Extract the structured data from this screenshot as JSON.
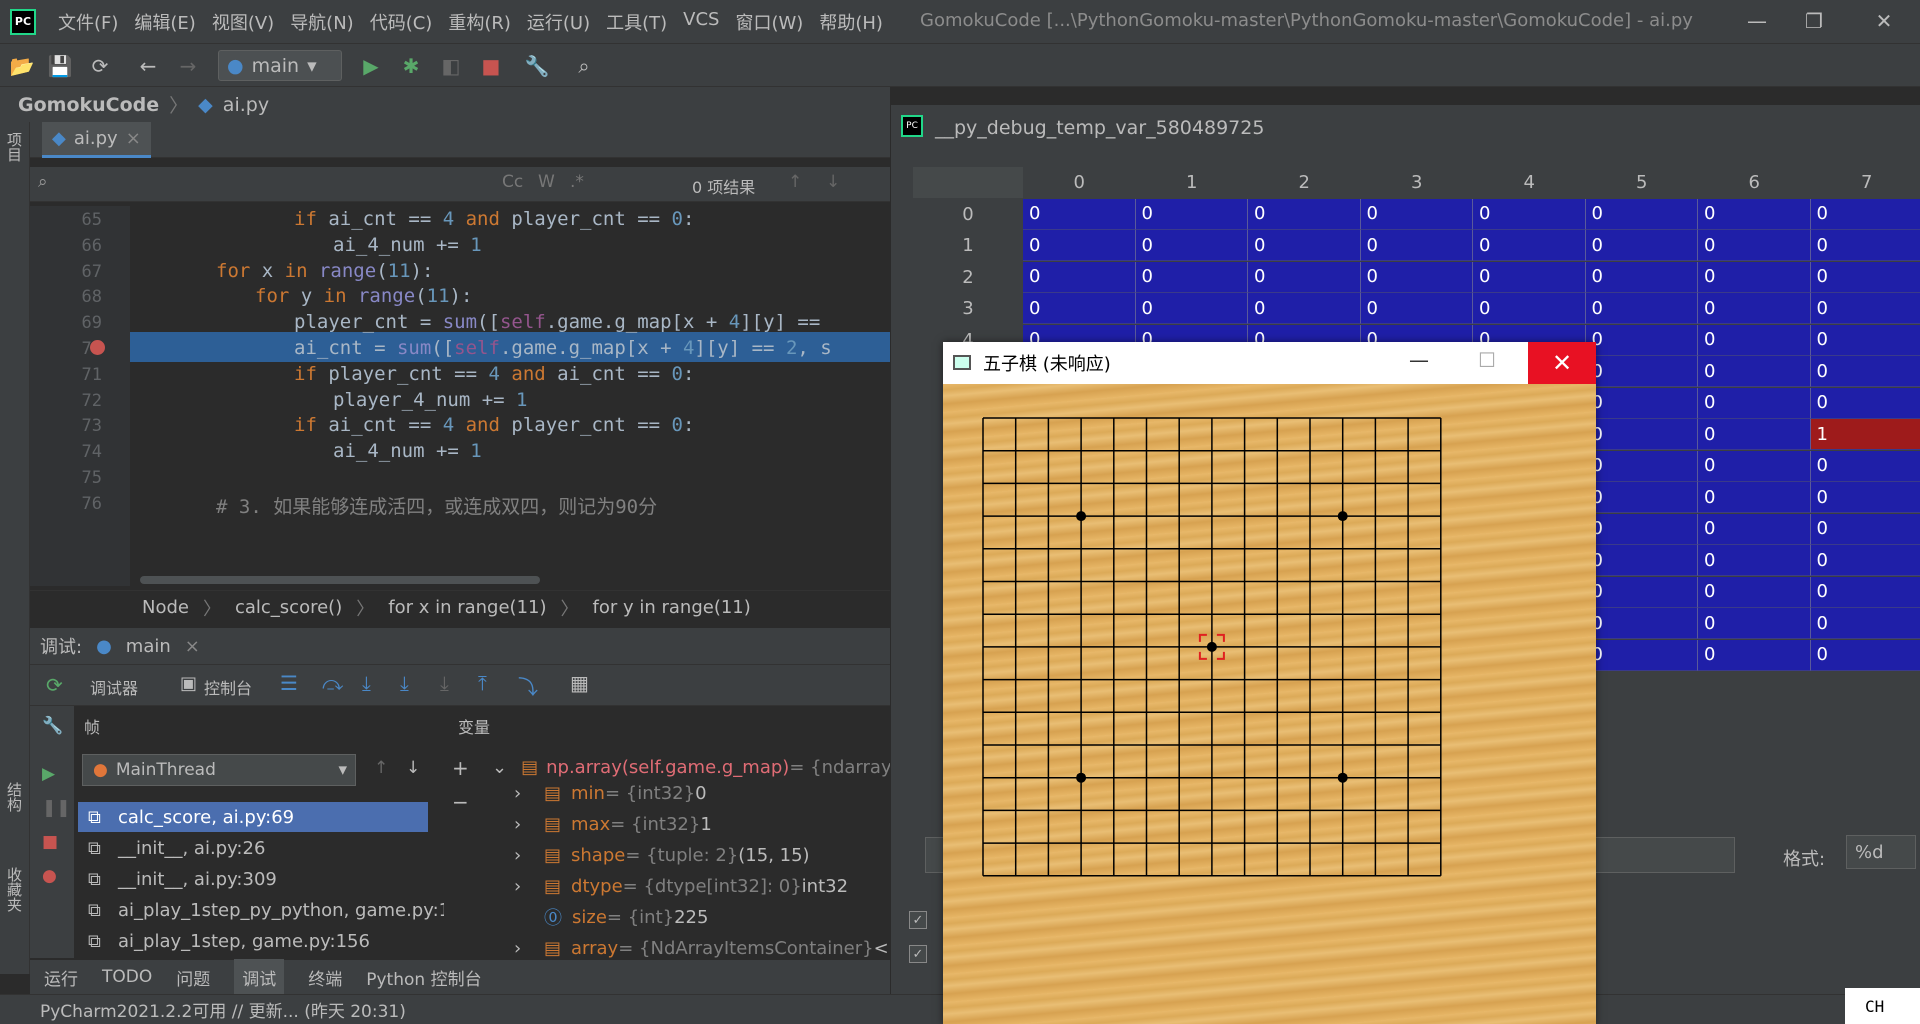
{
  "titlebar": {
    "menus": [
      "文件(F)",
      "编辑(E)",
      "视图(V)",
      "导航(N)",
      "代码(C)",
      "重构(R)",
      "运行(U)",
      "工具(T)",
      "VCS",
      "窗口(W)",
      "帮助(H)"
    ],
    "window_title": "GomokuCode [...\\PythonGomoku-master\\PythonGomoku-master\\GomokuCode] - ai.py"
  },
  "toolbar": {
    "run_config": "main"
  },
  "navbar": {
    "project": "GomokuCode",
    "file": "ai.py"
  },
  "left_strip": {
    "project": "项目",
    "structure": "结构",
    "favorites": "收藏夹"
  },
  "editor": {
    "tab": "ai.py",
    "find_results": "0 项结果",
    "lines": [
      {
        "n": "65",
        "indent": 4,
        "tokens": [
          [
            "kw",
            "if "
          ],
          [
            "",
            "ai_cnt == "
          ],
          [
            "num",
            "4"
          ],
          [
            "kw",
            " and "
          ],
          [
            "",
            "player_cnt == "
          ],
          [
            "num",
            "0"
          ],
          [
            "",
            ":"
          ]
        ]
      },
      {
        "n": "66",
        "indent": 5,
        "tokens": [
          [
            "",
            "ai_4_num += "
          ],
          [
            "num",
            "1"
          ]
        ]
      },
      {
        "n": "67",
        "indent": 2,
        "tokens": [
          [
            "kw",
            "for "
          ],
          [
            "",
            "x "
          ],
          [
            "kw",
            "in "
          ],
          [
            "bi",
            "range"
          ],
          [
            "",
            "("
          ],
          [
            "num",
            "11"
          ],
          [
            "",
            "):"
          ]
        ]
      },
      {
        "n": "68",
        "indent": 3,
        "tokens": [
          [
            "kw",
            "for "
          ],
          [
            "",
            "y "
          ],
          [
            "kw",
            "in "
          ],
          [
            "bi",
            "range"
          ],
          [
            "",
            "("
          ],
          [
            "num",
            "11"
          ],
          [
            "",
            "):"
          ]
        ]
      },
      {
        "n": "69",
        "indent": 4,
        "tokens": [
          [
            "",
            "player_cnt = "
          ],
          [
            "bi",
            "sum"
          ],
          [
            "",
            "(["
          ],
          [
            "self",
            "self"
          ],
          [
            "",
            ".game.g_map[x + "
          ],
          [
            "num",
            "4"
          ],
          [
            "",
            "][y] =="
          ]
        ]
      },
      {
        "n": "70",
        "indent": 4,
        "tokens": [
          [
            "",
            "ai_cnt = "
          ],
          [
            "bi",
            "sum"
          ],
          [
            "",
            "(["
          ],
          [
            "self",
            "self"
          ],
          [
            "",
            ".game.g_map[x + "
          ],
          [
            "num",
            "4"
          ],
          [
            "",
            "][y] == "
          ],
          [
            "num",
            "2"
          ],
          [
            "",
            ", s"
          ]
        ]
      },
      {
        "n": "71",
        "indent": 4,
        "tokens": [
          [
            "kw",
            "if "
          ],
          [
            "",
            "player_cnt == "
          ],
          [
            "num",
            "4"
          ],
          [
            "kw",
            " and "
          ],
          [
            "",
            "ai_cnt == "
          ],
          [
            "num",
            "0"
          ],
          [
            "",
            ":"
          ]
        ]
      },
      {
        "n": "72",
        "indent": 5,
        "tokens": [
          [
            "",
            "player_4_num += "
          ],
          [
            "num",
            "1"
          ]
        ]
      },
      {
        "n": "73",
        "indent": 4,
        "tokens": [
          [
            "kw",
            "if "
          ],
          [
            "",
            "ai_cnt == "
          ],
          [
            "num",
            "4"
          ],
          [
            "kw",
            " and "
          ],
          [
            "",
            "player_cnt == "
          ],
          [
            "num",
            "0"
          ],
          [
            "",
            ":"
          ]
        ]
      },
      {
        "n": "74",
        "indent": 5,
        "tokens": [
          [
            "",
            "ai_4_num += "
          ],
          [
            "num",
            "1"
          ]
        ]
      },
      {
        "n": "75",
        "indent": 0,
        "tokens": []
      },
      {
        "n": "76",
        "indent": 2,
        "tokens": [
          [
            "cm",
            "# 3. 如果能够连成活四，或连成双四，则记为90分"
          ]
        ]
      }
    ]
  },
  "breadcrumbs": [
    "Node",
    "calc_score()",
    "for x in range(11)",
    "for y in range(11)"
  ],
  "debug": {
    "label": "调试:",
    "session": "main",
    "debugger_tab": "调试器",
    "console_tab": "控制台",
    "frames_header": "帧",
    "vars_header": "变量",
    "thread": "MainThread",
    "frames": [
      "calc_score, ai.py:69",
      "__init__, ai.py:26",
      "__init__, ai.py:309",
      "ai_play_1step_py_python, game.py:13",
      "ai_play_1step, game.py:156"
    ],
    "root_var": {
      "name": "np.array(self.game.g_map)",
      "rest": " = {ndarray: ("
    },
    "vars": [
      {
        "name": "min",
        "type": " = {int32} ",
        "value": "0"
      },
      {
        "name": "max",
        "type": " = {int32} ",
        "value": "1"
      },
      {
        "name": "shape",
        "type": " = {tuple: 2} ",
        "value": "(15, 15)"
      },
      {
        "name": "dtype",
        "type": " = {dtype[int32]: 0} ",
        "value": "int32"
      },
      {
        "name": "size",
        "type": " = {int} ",
        "value": "225"
      },
      {
        "name": "array",
        "type": " = {NdArrayItemsContainer} ",
        "value": "<p"
      }
    ]
  },
  "bottom_tabs": [
    "运行",
    "TODO",
    "问题",
    "调试",
    "终端",
    "Python 控制台"
  ],
  "status": "PyCharm2021.2.2可用 // 更新... (昨天 20:31)",
  "array_viewer": {
    "title": "__py_debug_temp_var_580489725",
    "columns": [
      "0",
      "1",
      "2",
      "3",
      "4",
      "5",
      "6",
      "7"
    ],
    "rows": [
      "0",
      "1",
      "2",
      "3",
      "4"
    ],
    "format_label": "格式:",
    "format_value": "%d",
    "cell_value": "0",
    "highlight_value": "1",
    "colors": {
      "cell": "#1f1fa8",
      "highlight": "#9e1b1b"
    }
  },
  "gomoku": {
    "title": "五子棋 (未响应)",
    "board_size": 15,
    "stones": [
      [
        3,
        3
      ],
      [
        11,
        3
      ],
      [
        3,
        11
      ],
      [
        11,
        11
      ],
      [
        7,
        7
      ]
    ],
    "cursor": [
      7,
      7
    ]
  },
  "ime": "CH"
}
